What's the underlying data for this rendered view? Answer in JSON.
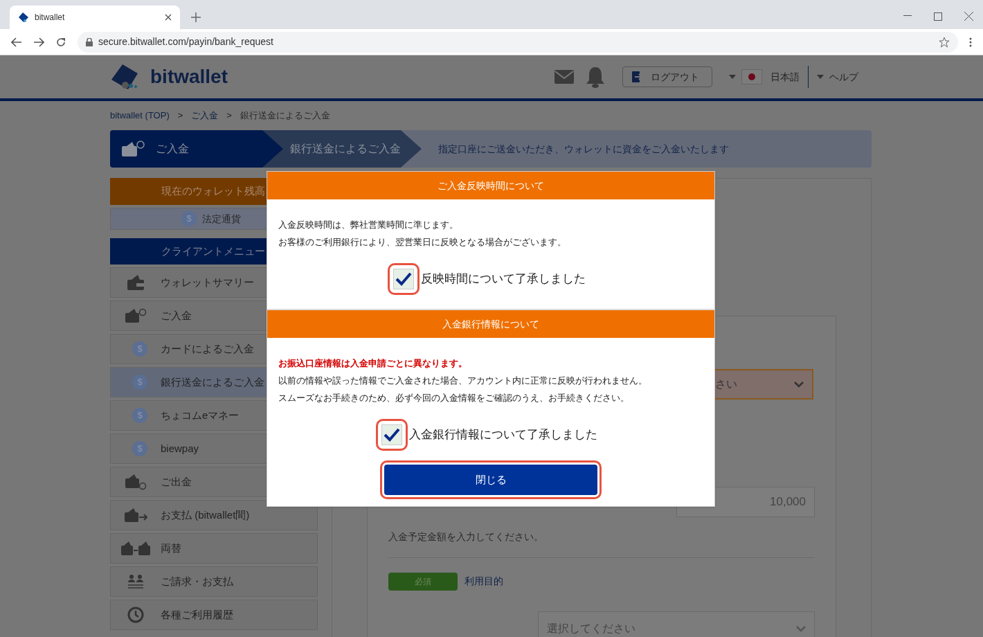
{
  "browser": {
    "tab_title": "bitwallet",
    "url": "secure.bitwallet.com/payin/bank_request"
  },
  "header": {
    "brand": "bitwallet",
    "logout": "ログアウト",
    "language": "日本語",
    "help": "ヘルプ"
  },
  "breadcrumb": [
    {
      "label": "bitwallet (TOP)",
      "kind": "link"
    },
    {
      "label": ">",
      "kind": "separator"
    },
    {
      "label": "ご入金",
      "kind": "link"
    },
    {
      "label": ">",
      "kind": "separator"
    },
    {
      "label": "銀行送金によるご入金",
      "kind": "current"
    }
  ],
  "steps": [
    {
      "label": "ご入金",
      "selected": true
    },
    {
      "label": "銀行送金によるご入金",
      "selected": false
    }
  ],
  "step_description": "指定口座にご送金いただき、ウォレットに資金をご入金いたします",
  "sidebar": {
    "balance_title": "現在のウォレット残高",
    "currency_symbol": "$",
    "currency": "法定通貨",
    "menu_title": "クライアントメニュー",
    "items": [
      {
        "label": "ウォレットサマリー",
        "kind": "wallet",
        "selected": false
      },
      {
        "label": "ご入金",
        "kind": "deposit",
        "selected": false,
        "children": [
          {
            "label": "カードによるご入金",
            "kind": "coin",
            "symbol": "$",
            "selected": false
          },
          {
            "label": "銀行送金によるご入金",
            "kind": "coin",
            "symbol": "$",
            "selected": true
          },
          {
            "label": "ちょコムeマネー",
            "kind": "coin",
            "symbol": "$",
            "selected": false
          },
          {
            "label": "biewpay",
            "kind": "coin",
            "symbol": "$",
            "selected": false
          }
        ]
      },
      {
        "label": "ご出金",
        "kind": "withdraw",
        "selected": false
      },
      {
        "label": "お支払 (bitwallet間)",
        "kind": "transfer",
        "selected": false
      },
      {
        "label": "両替",
        "kind": "exchange",
        "selected": false
      },
      {
        "label": "ご請求・お支払",
        "kind": "request",
        "selected": false
      },
      {
        "label": "各種ご利用履歴",
        "kind": "history",
        "selected": false
      }
    ]
  },
  "form": {
    "select_fragment": "さい",
    "amount": "10,000",
    "amount_hint": "入金予定金額を入力してください。",
    "required_badge": "必須",
    "purpose_label": "利用目的",
    "purpose_placeholder": "選択してください"
  },
  "modal": {
    "sections": [
      {
        "title": "ご入金反映時間について",
        "paragraphs": [
          {
            "text": "入金反映時間は、弊社営業時間に準じます。",
            "kind": "normal"
          },
          {
            "text": "お客様のご利用銀行により、翌営業日に反映となる場合がございます。",
            "kind": "normal"
          }
        ],
        "acknowledgement": {
          "label": "反映時間について了承しました",
          "checked": true
        }
      },
      {
        "title": "入金銀行情報について",
        "paragraphs": [
          {
            "text": "お振込口座情報は入金申請ごとに異なります。",
            "kind": "warning"
          },
          {
            "text": "以前の情報や誤った情報でご入金された場合、アカウント内に正常に反映が行われません。",
            "kind": "normal"
          },
          {
            "text": "スムーズなお手続きのため、必ず今回の入金情報をご確認のうえ、お手続きください。",
            "kind": "normal"
          }
        ],
        "acknowledgement": {
          "label": "入金銀行情報について了承しました",
          "checked": true
        }
      }
    ],
    "close_button": "閉じる"
  }
}
